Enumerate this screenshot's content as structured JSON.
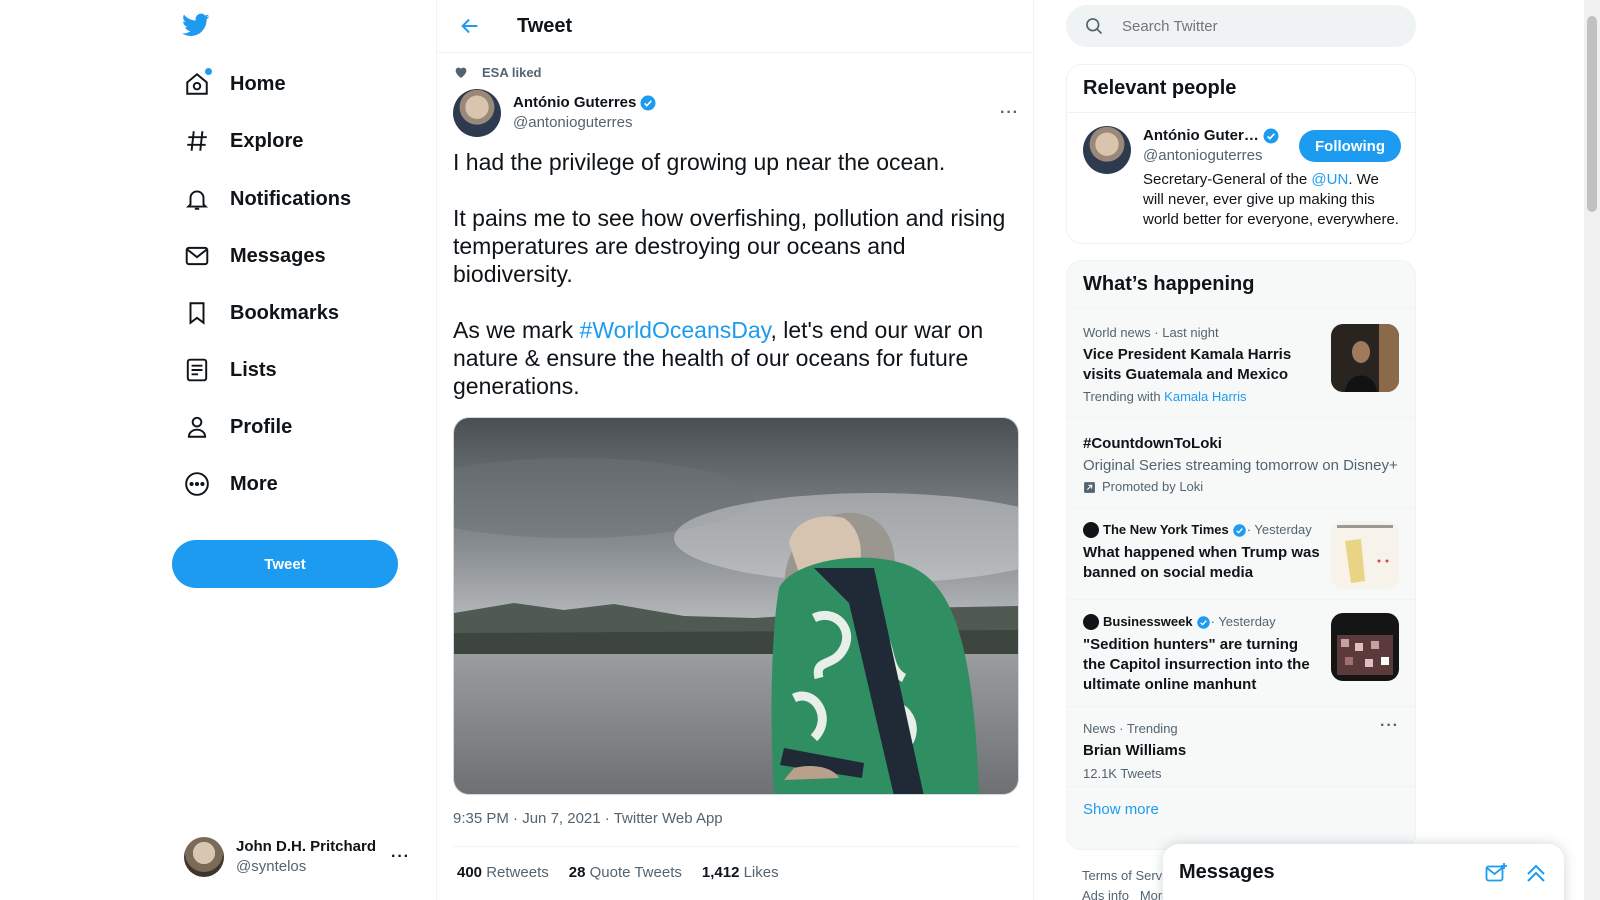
{
  "nav": {
    "items": [
      {
        "label": "Home",
        "icon": "home-icon"
      },
      {
        "label": "Explore",
        "icon": "hashtag-icon"
      },
      {
        "label": "Notifications",
        "icon": "bell-icon"
      },
      {
        "label": "Messages",
        "icon": "mail-icon"
      },
      {
        "label": "Bookmarks",
        "icon": "bookmark-icon"
      },
      {
        "label": "Lists",
        "icon": "list-icon"
      },
      {
        "label": "Profile",
        "icon": "person-icon"
      },
      {
        "label": "More",
        "icon": "more-circle-icon"
      }
    ],
    "tweet_button": "Tweet",
    "account": {
      "name": "John D.H. Pritchard",
      "handle": "@syntelos",
      "more": "···"
    }
  },
  "tweet": {
    "header_title": "Tweet",
    "social_context": "ESA liked",
    "author_name": "António Guterres",
    "author_handle": "@antonioguterres",
    "more": "···",
    "text": {
      "p1": "I had the privilege of growing up near the ocean.",
      "p2": "It pains me to see how overfishing, pollution and rising temperatures are destroying our oceans and biodiversity.",
      "p3_before": "As we mark ",
      "p3_hashtag": "#WorldOceansDay",
      "p3_after": ", let's end our war on nature & ensure the health of our oceans for future generations."
    },
    "time": "9:35 PM",
    "date": "Jun 7, 2021",
    "source": "Twitter Web App",
    "sep": " · ",
    "stats": {
      "retweets_count": "400",
      "retweets_label": "Retweets",
      "quotes_count": "28",
      "quotes_label": "Quote Tweets",
      "likes_count": "1,412",
      "likes_label": "Likes"
    }
  },
  "search": {
    "placeholder": "Search Twitter"
  },
  "relevant_people": {
    "title": "Relevant people",
    "name": "António Guter…",
    "handle": "@antonioguterres",
    "follow_label": "Following",
    "bio_before": "Secretary-General of the ",
    "bio_link": "@UN",
    "bio_after": ". We will never, ever give up making this world better for everyone, everywhere."
  },
  "whats_happening": {
    "title": "What’s happening",
    "trends": [
      {
        "context": "World news · Last night",
        "headline": "Vice President Kamala Harris visits Guatemala and Mexico",
        "sub_prefix": "Trending with ",
        "sub_link": "Kamala Harris"
      },
      {
        "headline": "#CountdownToLoki",
        "desc": "Original Series streaming tomorrow on Disney+",
        "promo": "Promoted by Loki"
      },
      {
        "source": "The New York Times",
        "when": " · Yesterday",
        "headline": "What happened when Trump was banned on social media"
      },
      {
        "source": "Businessweek",
        "when": " · Yesterday",
        "headline": "\"Sedition hunters\" are turning the Capitol insurrection into the ultimate online manhunt"
      },
      {
        "context": "News · Trending",
        "headline": "Brian Williams",
        "sub": "12.1K Tweets",
        "more": "···"
      }
    ],
    "show_more": "Show more"
  },
  "footer": {
    "line1": "Terms of Servi",
    "line2a": "Ads info",
    "line2b": "More"
  },
  "messages_drawer": {
    "title": "Messages"
  },
  "colors": {
    "accent": "#1d9bf0",
    "text": "#0f1419",
    "secondary": "#536471"
  }
}
